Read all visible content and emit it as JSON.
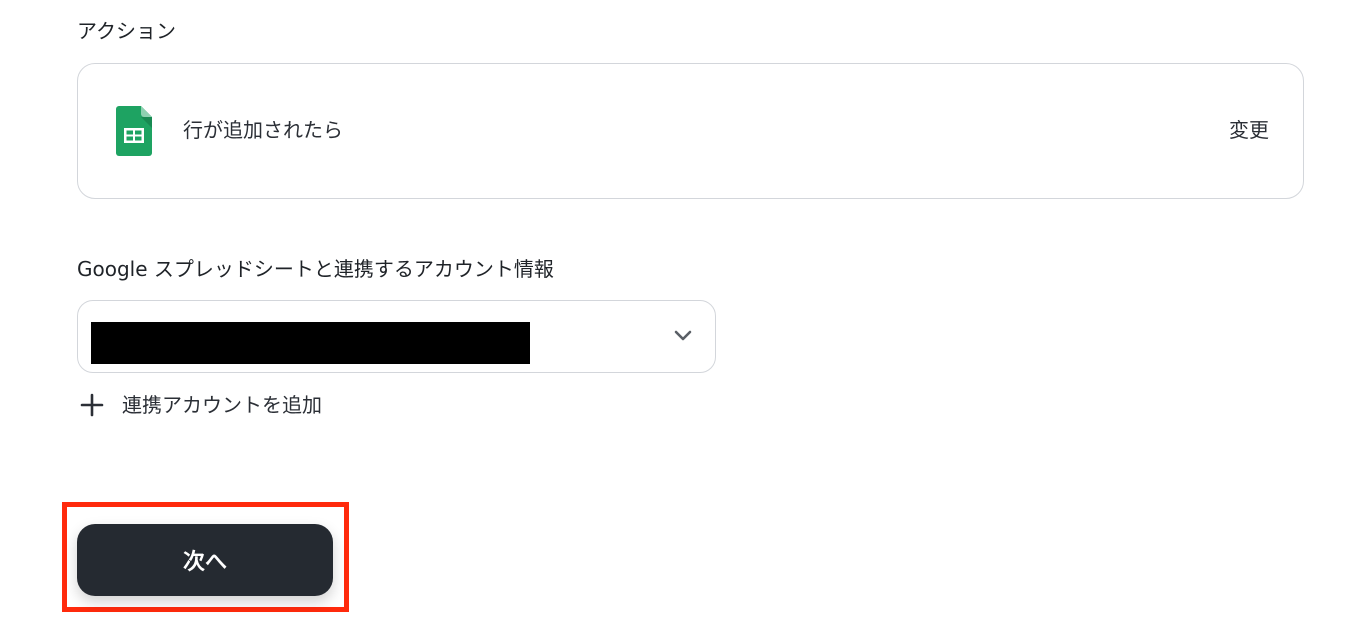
{
  "action_section": {
    "label": "アクション",
    "card": {
      "icon": "google-sheets-icon",
      "action_name": "行が追加されたら",
      "change_label": "変更"
    }
  },
  "account_section": {
    "label": "Google スプレッドシートと連携するアカウント情報",
    "select": {
      "value": "",
      "value_redacted": true,
      "chevron_icon": "chevron-down-icon"
    },
    "add_account": {
      "icon": "plus-icon",
      "label": "連携アカウントを追加"
    }
  },
  "footer": {
    "next_label": "次へ",
    "highlight_color": "#ff2a0c",
    "button_color": "#252a31"
  }
}
